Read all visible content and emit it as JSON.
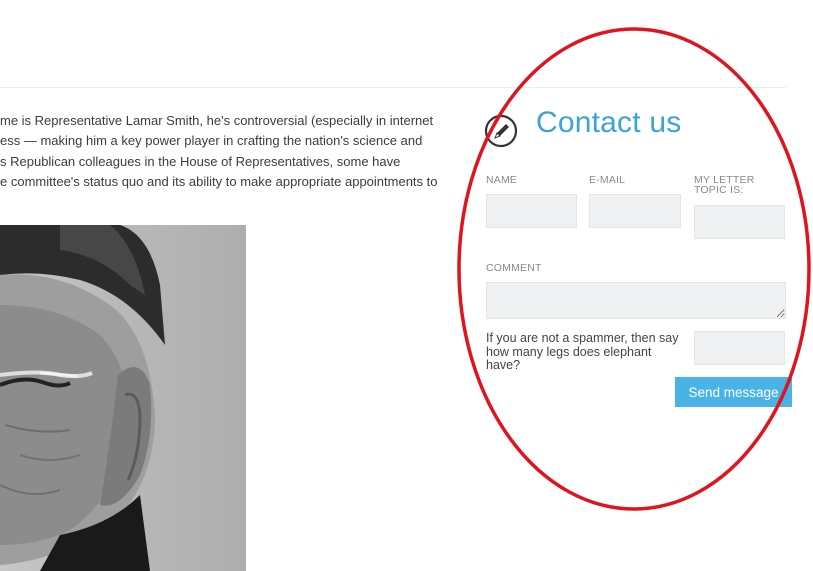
{
  "article": {
    "lines": [
      "me is Representative Lamar Smith, he's controversial (especially in internet",
      "ess — making him a key power player in crafting the nation's science and",
      "s Republican colleagues in the House of Representatives, some have",
      "e committee's status quo and its ability to make appropriate appointments to"
    ]
  },
  "contact": {
    "title": "Contact us",
    "name_label": "NAME",
    "email_label": "E-MAIL",
    "topic_label": "MY LETTER TOPIC IS:",
    "comment_label": "COMMENT",
    "spam_question": "If you are not a spammer, then say how many legs does elephant have?",
    "send_label": "Send message"
  },
  "colors": {
    "accent": "#3aa3d8",
    "button": "#4ab3e6",
    "annotation": "#e0141e"
  }
}
